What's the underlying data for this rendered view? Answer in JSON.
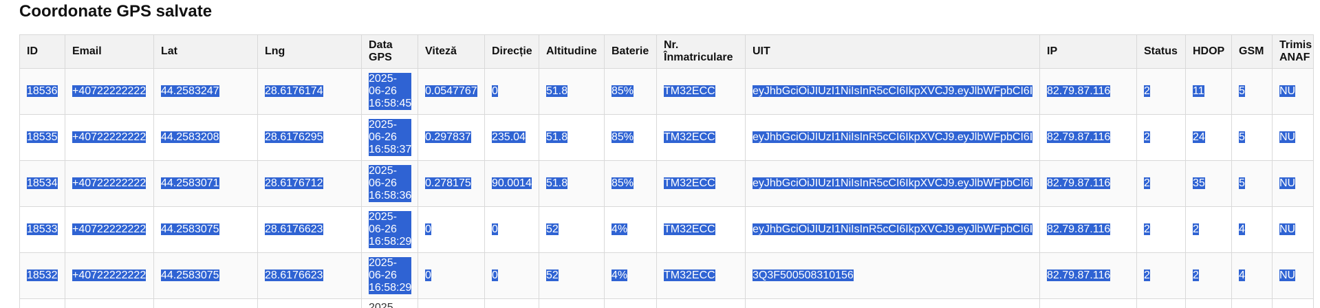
{
  "page": {
    "title": "Coordonate GPS salvate"
  },
  "table": {
    "headers": [
      "ID",
      "Email",
      "Lat",
      "Lng",
      "Data GPS",
      "Viteză",
      "Direcție",
      "Altitudine",
      "Baterie",
      "Nr. Înmatriculare",
      "UIT",
      "IP",
      "Status",
      "HDOP",
      "GSM",
      "Trimis ANAF"
    ],
    "rows": [
      [
        "18536",
        "+40722222222",
        "44.2583247",
        "28.6176174",
        "2025-06-26 16:58:45",
        "0.0547767",
        "0",
        "51.8",
        "85%",
        "TM32ECC",
        "eyJhbGciOiJIUzI1NiIsInR5cCI6IkpXVCJ9.eyJlbWFpbCI6I",
        "82.79.87.116",
        "2",
        "11",
        "5",
        "NU"
      ],
      [
        "18535",
        "+40722222222",
        "44.2583208",
        "28.6176295",
        "2025-06-26 16:58:37",
        "0.297837",
        "235.04",
        "51.8",
        "85%",
        "TM32ECC",
        "eyJhbGciOiJIUzI1NiIsInR5cCI6IkpXVCJ9.eyJlbWFpbCI6I",
        "82.79.87.116",
        "2",
        "24",
        "5",
        "NU"
      ],
      [
        "18534",
        "+40722222222",
        "44.2583071",
        "28.6176712",
        "2025-06-26 16:58:36",
        "0.278175",
        "90.0014",
        "51.8",
        "85%",
        "TM32ECC",
        "eyJhbGciOiJIUzI1NiIsInR5cCI6IkpXVCJ9.eyJlbWFpbCI6I",
        "82.79.87.116",
        "2",
        "35",
        "5",
        "NU"
      ],
      [
        "18533",
        "+40722222222",
        "44.2583075",
        "28.6176623",
        "2025-06-26 16:58:29",
        "0",
        "0",
        "52",
        "4%",
        "TM32ECC",
        "eyJhbGciOiJIUzI1NiIsInR5cCI6IkpXVCJ9.eyJlbWFpbCI6I",
        "82.79.87.116",
        "2",
        "2",
        "4",
        "NU"
      ],
      [
        "18532",
        "+40722222222",
        "44.2583075",
        "28.6176623",
        "2025-06-26 16:58:29",
        "0",
        "0",
        "52",
        "4%",
        "TM32ECC",
        "3Q3F500508310156",
        "82.79.87.116",
        "2",
        "2",
        "4",
        "NU"
      ]
    ],
    "partial_row_date": "2025"
  },
  "colors": {
    "selection": "#2f63d3",
    "header_bg": "#f2f2f2",
    "border": "#d9d9d9"
  }
}
